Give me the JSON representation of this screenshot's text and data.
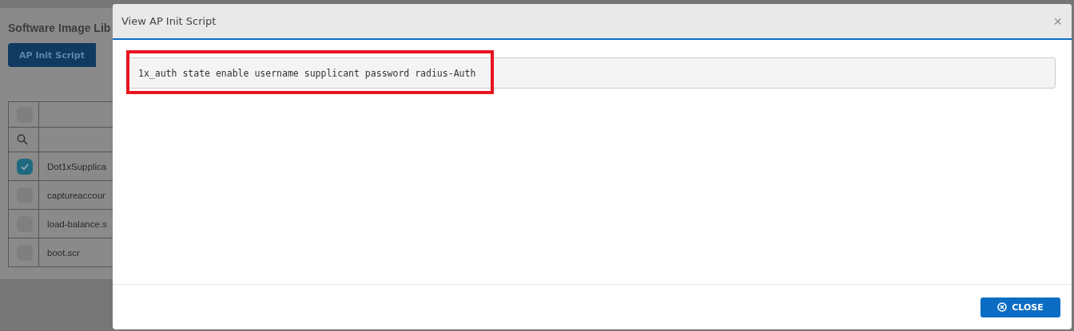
{
  "page": {
    "title": "Software Image Lib",
    "tabs": [
      {
        "label": "AP Init Script",
        "selected": true
      }
    ],
    "table": {
      "all_checked": false,
      "rows": [
        {
          "name": "Dot1xSupplica",
          "checked": true
        },
        {
          "name": "captureaccour",
          "checked": false
        },
        {
          "name": "load-balance.s",
          "checked": false
        },
        {
          "name": "boot.scr",
          "checked": false
        }
      ]
    }
  },
  "dialog": {
    "title": "View AP Init Script",
    "script": "1x_auth state enable username supplicant password radius-Auth",
    "script_highlighted": true,
    "close_icon": "×",
    "close_button": "CLOSE"
  }
}
